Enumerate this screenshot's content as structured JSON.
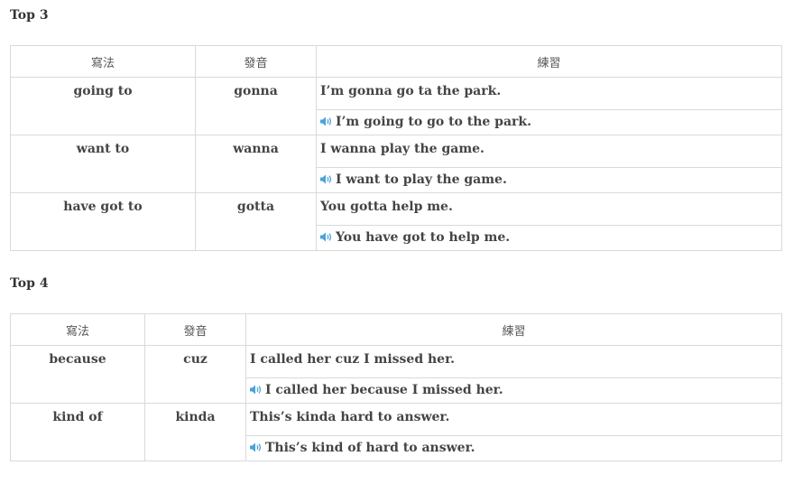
{
  "sections": [
    {
      "title": "Top 3",
      "headers": [
        "寫法",
        "發音",
        "練習"
      ],
      "rows": [
        {
          "spelling": "going to",
          "pronunciation": "gonna",
          "example": "I’m gonna go ta the park.",
          "audio_example": "I’m going to go to the park."
        },
        {
          "spelling": "want to",
          "pronunciation": "wanna",
          "example": "I wanna play the game.",
          "audio_example": "I want to play the game."
        },
        {
          "spelling": "have got to",
          "pronunciation": "gotta",
          "example": "You gotta help me.",
          "audio_example": "You have got to help me."
        }
      ]
    },
    {
      "title": "Top 4",
      "headers": [
        "寫法",
        "發音",
        "練習"
      ],
      "rows": [
        {
          "spelling": "because",
          "pronunciation": "cuz",
          "example": "I called her cuz I missed her.",
          "audio_example": "I called her because I missed her."
        },
        {
          "spelling": "kind of",
          "pronunciation": "kinda",
          "example": "This’s kinda hard to answer.",
          "audio_example": "This’s kind of hard to answer."
        }
      ]
    }
  ],
  "icons": {
    "speaker": "speaker-icon"
  },
  "colors": {
    "speaker": "#4aa3d8",
    "border": "#d9d9d9",
    "text": "#444444"
  }
}
